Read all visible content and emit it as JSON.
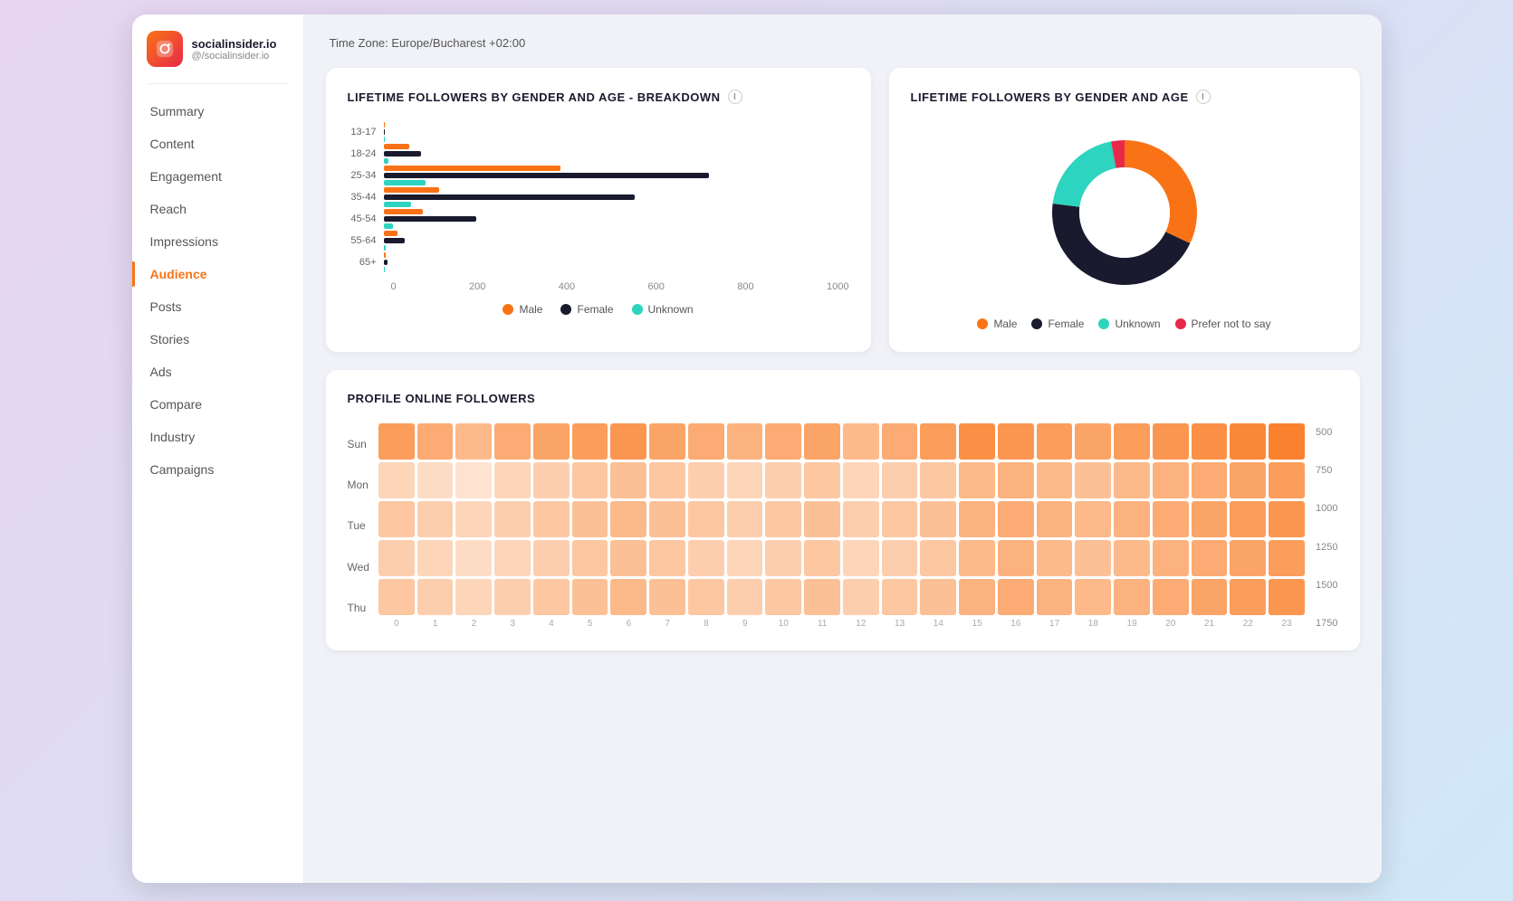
{
  "brand": {
    "name": "socialinsider.io",
    "handle": "@/socialinsider.io",
    "icon": "📷"
  },
  "timezone": "Time Zone: Europe/Bucharest +02:00",
  "sidebar": {
    "items": [
      {
        "label": "Summary",
        "active": false
      },
      {
        "label": "Content",
        "active": false
      },
      {
        "label": "Engagement",
        "active": false
      },
      {
        "label": "Reach",
        "active": false
      },
      {
        "label": "Impressions",
        "active": false
      },
      {
        "label": "Audience",
        "active": true
      },
      {
        "label": "Posts",
        "active": false
      },
      {
        "label": "Stories",
        "active": false
      },
      {
        "label": "Ads",
        "active": false
      },
      {
        "label": "Compare",
        "active": false
      },
      {
        "label": "Industry",
        "active": false
      },
      {
        "label": "Campaigns",
        "active": false
      }
    ]
  },
  "chart1": {
    "title": "LIFETIME FOLLOWERS BY GENDER AND AGE - BREAKDOWN",
    "age_groups": [
      "13-17",
      "18-24",
      "25-34",
      "35-44",
      "45-54",
      "55-64",
      "65+"
    ],
    "bars": [
      {
        "male": 1,
        "female": 2,
        "unknown": 1
      },
      {
        "male": 55,
        "female": 80,
        "unknown": 10
      },
      {
        "male": 380,
        "female": 700,
        "unknown": 90
      },
      {
        "male": 120,
        "female": 540,
        "unknown": 60
      },
      {
        "male": 85,
        "female": 200,
        "unknown": 20
      },
      {
        "male": 30,
        "female": 45,
        "unknown": 5
      },
      {
        "male": 5,
        "female": 8,
        "unknown": 2
      }
    ],
    "max_val": 1000,
    "x_ticks": [
      "0",
      "200",
      "400",
      "600",
      "800",
      "1000"
    ],
    "legend": {
      "male_label": "Male",
      "female_label": "Female",
      "unknown_label": "Unknown"
    }
  },
  "chart2": {
    "title": "LIFETIME FOLLOWERS BY GENDER AND AGE",
    "legend": {
      "male_label": "Male",
      "female_label": "Female",
      "unknown_label": "Unknown",
      "prefer_label": "Prefer not to say"
    },
    "donut": {
      "male_pct": 32,
      "female_pct": 45,
      "unknown_pct": 20,
      "prefer_pct": 3
    }
  },
  "chart3": {
    "title": "PROFILE ONLINE FOLLOWERS",
    "y_labels": [
      "Sun",
      "Mon",
      "Tue",
      "Wed",
      "Thu"
    ],
    "x_labels": [
      "0",
      "1",
      "2",
      "3",
      "4",
      "5",
      "6",
      "7",
      "8",
      "9",
      "10",
      "11",
      "12",
      "13",
      "14",
      "15",
      "16",
      "17",
      "18",
      "19",
      "20",
      "21",
      "22",
      "23"
    ],
    "right_labels": [
      "500",
      "750",
      "1000",
      "1250",
      "1500",
      "1750"
    ],
    "heatmap_intensities": [
      [
        0.7,
        0.6,
        0.5,
        0.6,
        0.65,
        0.7,
        0.75,
        0.65,
        0.6,
        0.55,
        0.6,
        0.65,
        0.5,
        0.6,
        0.7,
        0.8,
        0.75,
        0.7,
        0.65,
        0.7,
        0.75,
        0.8,
        0.85,
        0.9
      ],
      [
        0.3,
        0.25,
        0.2,
        0.3,
        0.35,
        0.4,
        0.45,
        0.4,
        0.35,
        0.3,
        0.35,
        0.4,
        0.3,
        0.35,
        0.4,
        0.5,
        0.55,
        0.5,
        0.45,
        0.5,
        0.55,
        0.6,
        0.65,
        0.7
      ],
      [
        0.4,
        0.35,
        0.3,
        0.35,
        0.4,
        0.45,
        0.5,
        0.45,
        0.4,
        0.35,
        0.4,
        0.45,
        0.35,
        0.4,
        0.45,
        0.55,
        0.6,
        0.55,
        0.5,
        0.55,
        0.6,
        0.65,
        0.7,
        0.75
      ],
      [
        0.35,
        0.3,
        0.25,
        0.3,
        0.35,
        0.4,
        0.45,
        0.4,
        0.35,
        0.3,
        0.35,
        0.4,
        0.3,
        0.35,
        0.4,
        0.5,
        0.55,
        0.5,
        0.45,
        0.5,
        0.55,
        0.6,
        0.65,
        0.7
      ],
      [
        0.4,
        0.35,
        0.3,
        0.35,
        0.4,
        0.45,
        0.5,
        0.45,
        0.4,
        0.35,
        0.4,
        0.45,
        0.35,
        0.4,
        0.45,
        0.55,
        0.6,
        0.55,
        0.5,
        0.55,
        0.6,
        0.65,
        0.7,
        0.75
      ]
    ]
  },
  "colors": {
    "male": "#f97316",
    "female": "#1a1a2e",
    "unknown": "#2dd4bf",
    "prefer": "#e8294a",
    "accent": "#f97316"
  }
}
